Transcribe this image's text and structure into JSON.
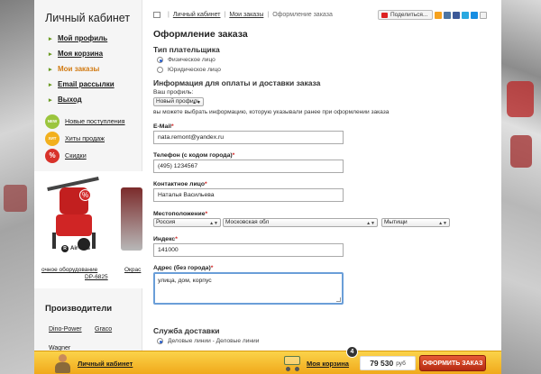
{
  "sidebar": {
    "title": "Личный кабинет",
    "menu": [
      {
        "label": "Мой профиль",
        "active": false
      },
      {
        "label": "Моя корзина",
        "active": false
      },
      {
        "label": "Мои заказы",
        "active": true
      },
      {
        "label": "Email рассылки",
        "active": false
      },
      {
        "label": "Выход",
        "active": false
      }
    ],
    "badges": [
      {
        "icon": "NEW",
        "label": "Новые поступления",
        "color": "#9bc53d"
      },
      {
        "icon": "ХИТ",
        "label": "Хиты продаж",
        "color": "#f2b01e"
      },
      {
        "icon": "%",
        "label": "Скидки",
        "color": "#d8322a"
      }
    ],
    "promo": {
      "brand": "Air-less",
      "badge": "%",
      "caption1": "очное оборудование",
      "caption2": "Окрас",
      "caption3": "DP-6825"
    },
    "manufacturers_title": "Производители",
    "manufacturers": [
      "Dino-Power",
      "Graco",
      "Wagner"
    ]
  },
  "breadcrumbs": [
    "Личный кабинет",
    "Мои заказы",
    "Оформление заказа"
  ],
  "share_label": "Поделиться...",
  "page_title": "Оформление заказа",
  "payer": {
    "heading": "Тип плательщика",
    "options": [
      {
        "label": "Физическое лицо",
        "checked": true
      },
      {
        "label": "Юридическое лицо",
        "checked": false
      }
    ]
  },
  "info_heading": "Информация для оплаты и доставки заказа",
  "profile": {
    "label": "Ваш профиль:",
    "value": "Новый профиль",
    "hint": "вы можете выбрать информацию, которую указывали ранее при оформлении заказа"
  },
  "fields": {
    "email_label": "E-Mail",
    "email_value": "nata.remont@yandex.ru",
    "phone_label": "Телефон (с кодом города)",
    "phone_value": "(495) 1234567",
    "contact_label": "Контактное лицо",
    "contact_value": "Наталья Васильева",
    "location_label": "Местоположение",
    "country": "Россия",
    "region": "Московская обл",
    "city": "Мытищи",
    "index_label": "Индекс",
    "index_value": "141000",
    "address_label": "Адрес (без города)",
    "address_value": "улица, дом, корпус"
  },
  "delivery": {
    "heading": "Служба доставки",
    "option": "Деловые линии - Деловые линии",
    "checked": true
  },
  "bottom_bar": {
    "cabinet_link": "Личный кабинет",
    "cart_link": "Моя корзина",
    "cart_count": "4",
    "total": "79 530",
    "currency": "руб",
    "order_button": "ОФОРМИТЬ ЗАКАЗ"
  },
  "colors": {
    "accent_orange": "#d17a12",
    "menu_arrow": "#6a9a20",
    "required": "#d02020",
    "bar_yellow": "#f8c33a",
    "order_red": "#c8361b",
    "focus_blue": "#6a9ed8"
  }
}
